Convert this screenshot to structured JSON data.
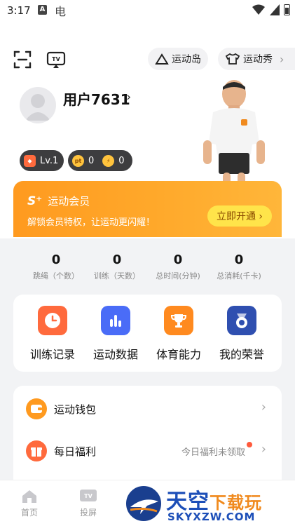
{
  "status_bar": {
    "time": "3:17",
    "notif_a": "A",
    "notif_b": "电"
  },
  "header": {
    "sport_island": "运动岛",
    "sport_show": "运动秀"
  },
  "profile": {
    "username": "用户7631",
    "level": "Lv.1",
    "pt_points": "0",
    "energy_points": "0",
    "pt_icon_text": "pt"
  },
  "vip": {
    "logo": "S⁺",
    "title": "运动会员",
    "subtitle": "解锁会员特权，让运动更闪耀！",
    "cta": "立即开通 ›"
  },
  "stats": [
    {
      "value": "0",
      "label": "跳绳（个数）"
    },
    {
      "value": "0",
      "label": "训练（天数）"
    },
    {
      "value": "0",
      "label": "总时间(分钟)"
    },
    {
      "value": "0",
      "label": "总消耗(千卡)"
    }
  ],
  "features": [
    {
      "label": "训练记录",
      "icon": "clock-icon",
      "color": "#ff6a3d"
    },
    {
      "label": "运动数据",
      "icon": "bar-chart-icon",
      "color": "#4a6cf7"
    },
    {
      "label": "体育能力",
      "icon": "trophy-icon",
      "color": "#ff8a1f"
    },
    {
      "label": "我的荣誉",
      "icon": "medal-icon",
      "color": "#2f4fb0"
    }
  ],
  "menu": [
    {
      "label": "运动钱包",
      "icon": "wallet-icon",
      "extra": ""
    },
    {
      "label": "每日福利",
      "icon": "gift-icon",
      "extra": "今日福利未领取"
    }
  ],
  "tabbar": [
    {
      "label": "首页",
      "icon": "home-icon"
    },
    {
      "label": "投屏",
      "icon": "tv-icon"
    }
  ],
  "watermark": {
    "title_main": "天空",
    "title_accent": "下载玩",
    "url": "SKYXZW.COM"
  }
}
